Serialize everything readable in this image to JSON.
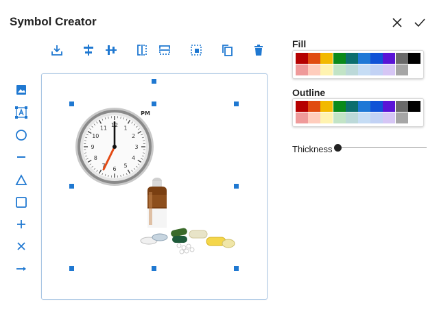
{
  "header": {
    "title": "Symbol Creator",
    "close_icon": "close-icon",
    "confirm_icon": "check-icon"
  },
  "toolbar": {
    "icons": [
      "download-icon",
      "align-horizontal-center-icon",
      "align-vertical-center-icon",
      "flip-horizontal-icon",
      "flip-vertical-icon",
      "group-icon",
      "copy-icon",
      "delete-icon"
    ]
  },
  "sidebar": {
    "tools": [
      "image-icon",
      "text-box-icon",
      "circle-icon",
      "line-icon",
      "triangle-icon",
      "square-icon",
      "plus-icon",
      "cross-icon",
      "arrow-icon"
    ]
  },
  "canvas": {
    "clock_label": "PM",
    "clock_numbers": [
      "12",
      "1",
      "2",
      "3",
      "4",
      "5",
      "6",
      "7",
      "8",
      "9",
      "10",
      "11"
    ]
  },
  "fill": {
    "label": "Fill"
  },
  "outline": {
    "label": "Outline"
  },
  "colors": {
    "row1": [
      "#b50000",
      "#e04b10",
      "#f2b900",
      "#0a8a1a",
      "#0c6e6e",
      "#1e78d6",
      "#1052d6",
      "#5a14d6",
      "#6a6a6a",
      "#000000"
    ],
    "row2": [
      "#ef9a9a",
      "#ffcdbd",
      "#fff3b0",
      "#c2e4c6",
      "#bcd9d9",
      "#c6ddf5",
      "#c2d2f5",
      "#d6c6f5",
      "#a6a6a6",
      "#ffffff"
    ],
    "accent": "#1f78d1"
  },
  "thickness": {
    "label": "Thickness",
    "value": 0
  }
}
